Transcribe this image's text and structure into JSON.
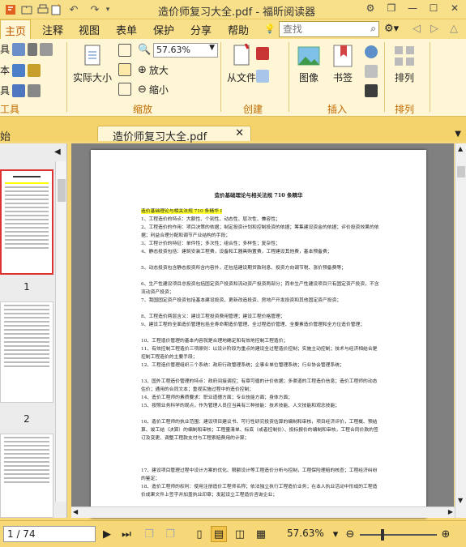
{
  "app": {
    "window_title": "造价师复习大全.pdf - 福昕阅读器"
  },
  "menu": {
    "tabs": [
      "主页",
      "注释",
      "视图",
      "表单",
      "保护",
      "分享",
      "帮助"
    ],
    "search_placeholder": "查找"
  },
  "ribbon": {
    "tools_group_label": "工具",
    "zoom_group_label": "缩放",
    "create_group_label": "创建",
    "insert_group_label": "插入",
    "arrange_group_label": "排列",
    "actual_size_label": "实际大小",
    "zoom_value": "57.63%",
    "zoom_in_label": "放大",
    "zoom_out_label": "缩小",
    "from_file_label": "从文件",
    "image_label": "图像",
    "bookmark_label": "书签",
    "arrange_label": "排列",
    "left_partial_labels": [
      "具",
      "本",
      "具"
    ]
  },
  "doc_tabs": {
    "start_tab": "始",
    "active_tab": "造价师复习大全.pdf"
  },
  "thumbnails": [
    {
      "number": "1"
    },
    {
      "number": "2"
    }
  ],
  "document": {
    "heading": "造价基础理论与相关法规 710 条精华",
    "highlighted_line": "造价基础理论与相关法规 710 条精华 I",
    "paragraphs": [
      "1、工程造价的特点：大额性、个别性、动态性、层次性、兼容性；",
      "2、工程造价的作用：项目决策的依据；制定投资计划和控制投资的依据；筹集建设资金的依据；评价投资效果的依据；利益合理分配和调节产业结构的手段；",
      "3、工程计价的特征：单件性；多次性；组合性；多样性；复杂性；",
      "4、静态投资包括：建筑安装工程费，设备和工器具购置费，工程建设其他费，基本预备费；",
      "5、动态投资包含静态投资所含内容外，还包括建设期贷款利息、投资方向调节税、涨价预备费等；",
      "6、生产性建设项目总投资包括固定资产投资和流动资产投资两部分；而非生产性建设项目只有固定资产投资，不含流动资产投资；",
      "7、我国固定资产投资包括基本建设投资、更新改造投资、房地产开发投资和其他固定资产投资；",
      "8、工程造价两层含义：建设工程投资费用管理；建设工程价格管理；",
      "9、建设工程的全面造价管理包括全寿命期造价管理、全过程造价管理、全要素造价管理和全方位造价管理；",
      "10、工程造价管理的基本内容就是合理地确定和有效地控制工程造价；",
      "11、有效控制工程造价三项原则：以设计阶段为重点的建设全过程造价控制；实施主动控制；技术与经济相结合是控制工程造价的主要手段；",
      "12、工程造价管理组织三个系统：政府行政管理系统；企事业单位管理系统；行业协会管理系统；",
      "13、国外工程造价管理的特点：政府间接调控；有章可循的计价依据；多渠道的工程造价信息；造价工程师的动态估价；通用的合同文本；重视实施过程中的造价控制；",
      "14、造价工程师的素质要求：职业道德方面；专业技能方面；身体方面；",
      "15、按照业务科学的观点，作为管理人员应当具有三种技能：技术技能、人文技能和观念技能；",
      "16、造价工程师的执业范围：建设项目建议书、可行性研究投资估算的编制和审核，项目经济评价，工程概、预结算、竣工结（决算）的编制和审核；工程量清单、标底（或者控制价）、投标报价的编制和审核，工程合同价款的签订及变更、调整工程款支付与工程索赔费用的计算；",
      "17、建设项目管理过程中设计方案的优化、限额设计等工程造价分析与控制，工程保险理赔的核查；工程经济纠纷的鉴定；",
      "18、造价工程师的权利：使用注册造价工程师名称；依法独立执行工程造价业务；在本人执业活动中形成的工程造价成果文件上签字并加盖执业印章；发起设立工程造价咨询企业；"
    ]
  },
  "statusbar": {
    "page_indicator": "1 / 74",
    "zoom_display": "57.63%"
  }
}
